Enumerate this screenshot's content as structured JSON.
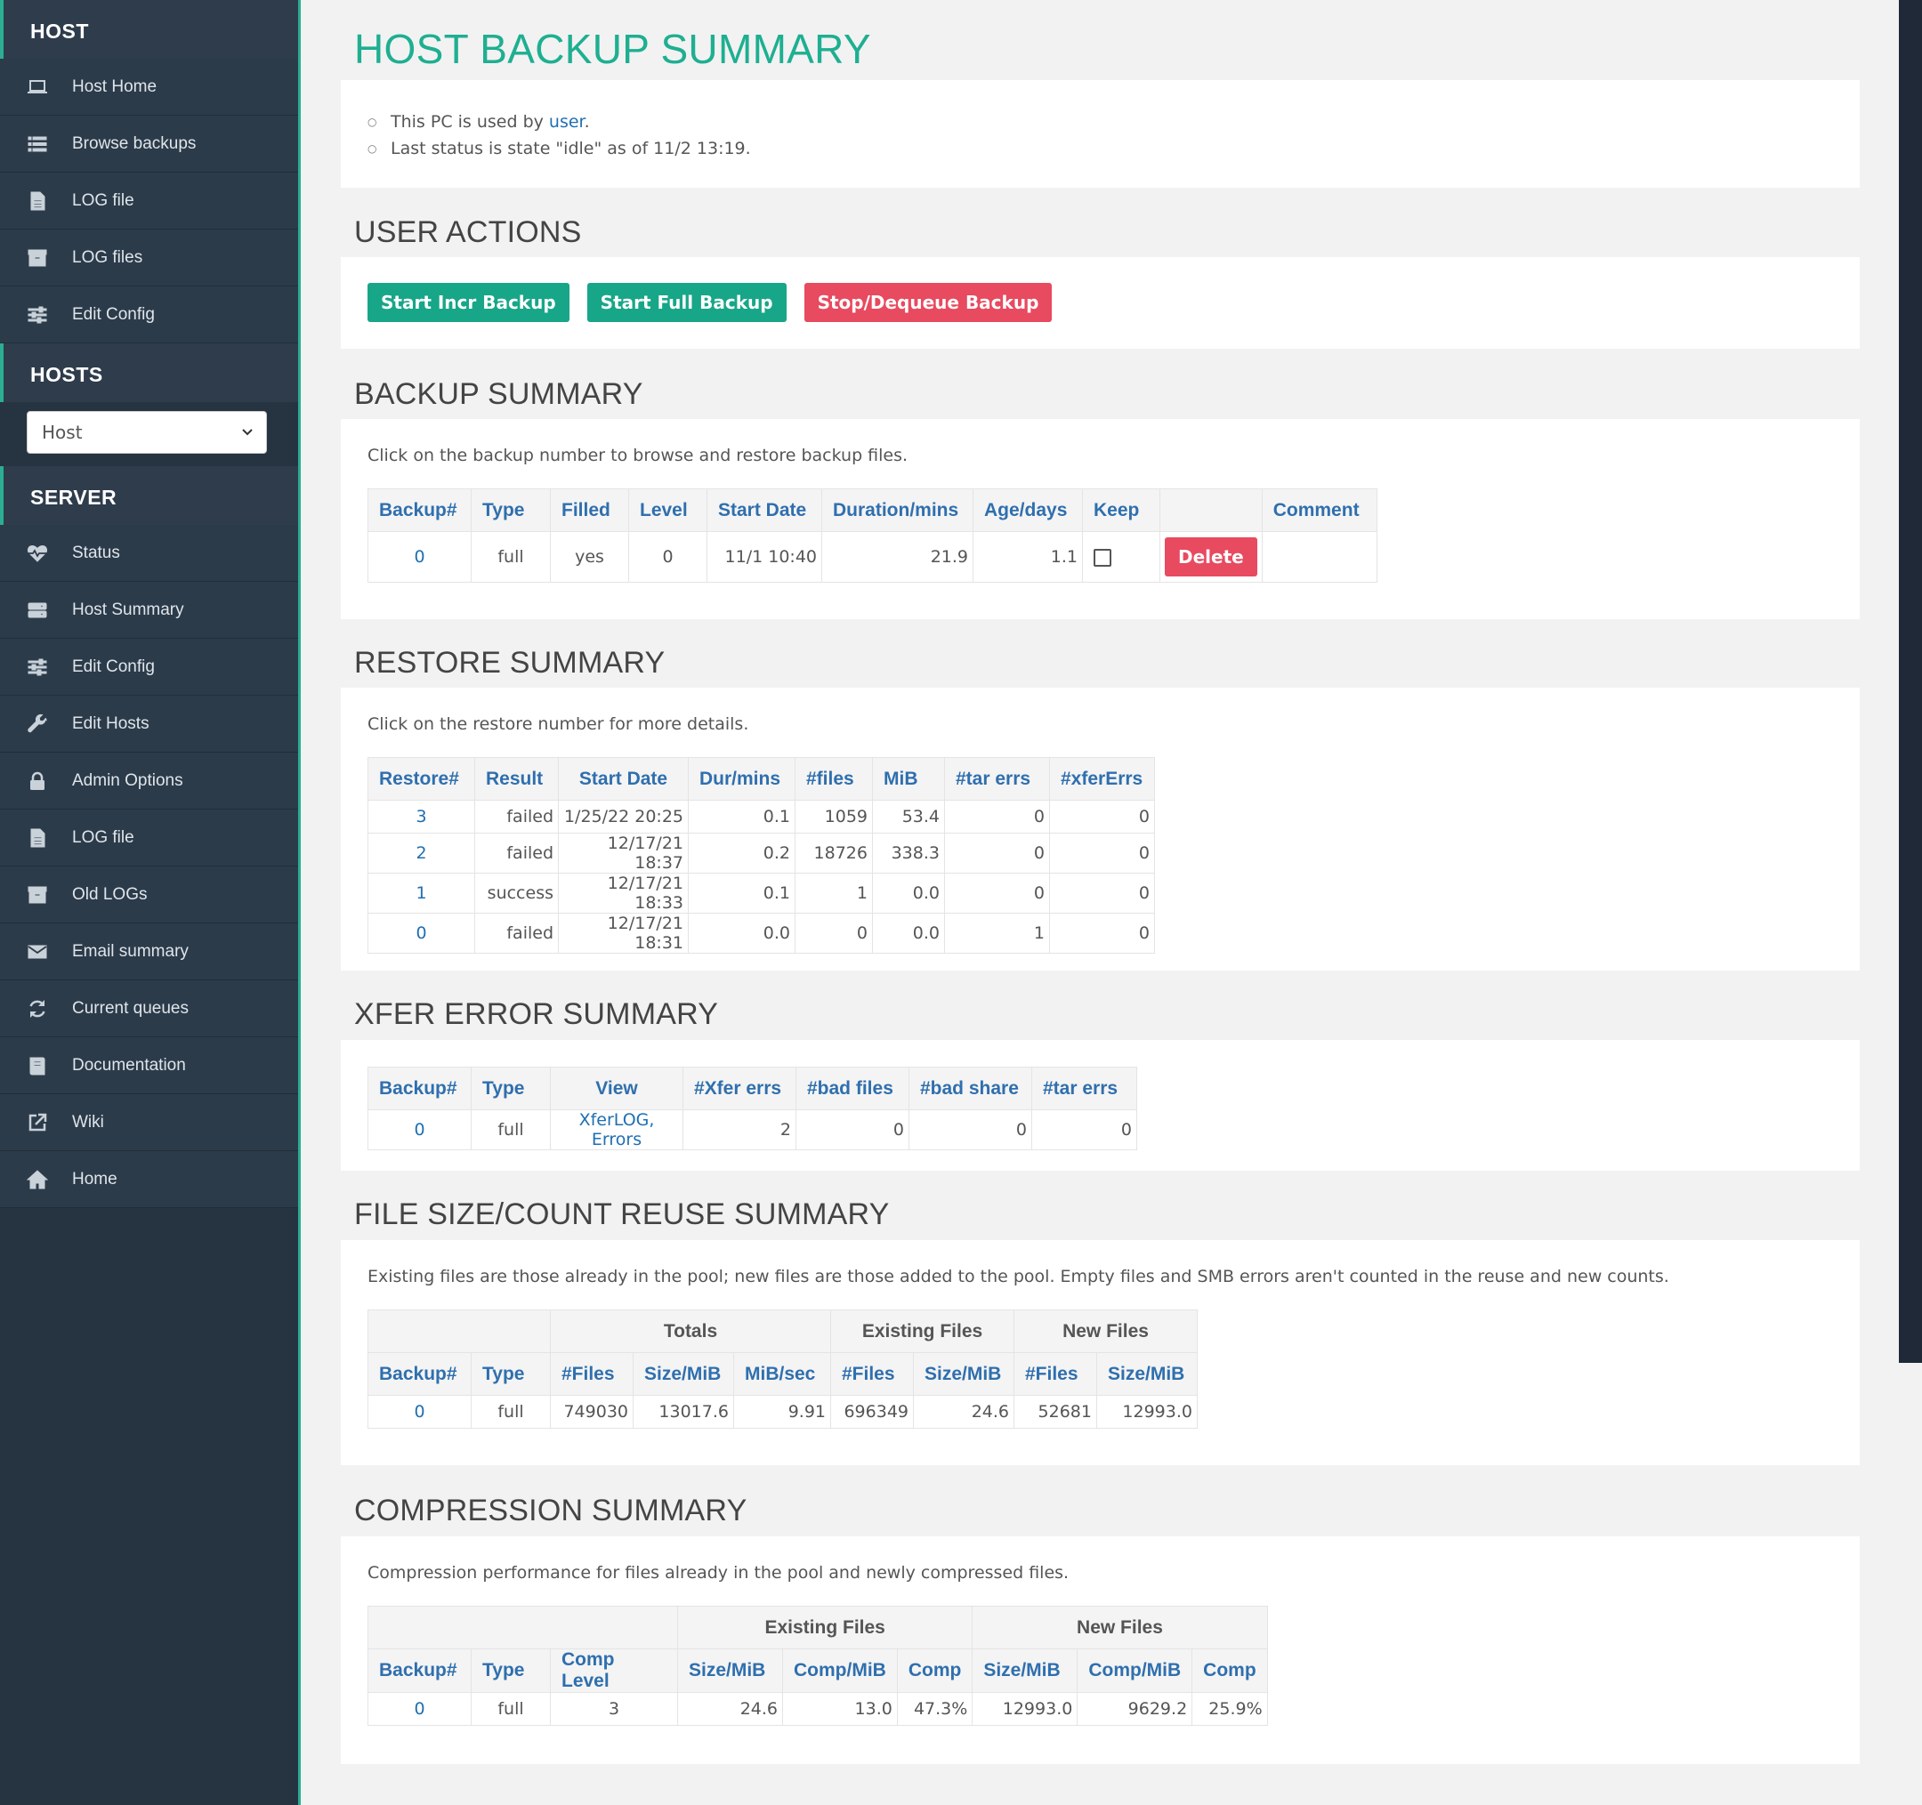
{
  "sidebar": {
    "host_header": "HOST",
    "host_items": [
      {
        "label": "Host Home",
        "icon": "laptop-icon"
      },
      {
        "label": "Browse backups",
        "icon": "list-icon"
      },
      {
        "label": "LOG file",
        "icon": "file-icon"
      },
      {
        "label": "LOG files",
        "icon": "archive-icon"
      },
      {
        "label": "Edit Config",
        "icon": "sliders-icon"
      }
    ],
    "hosts_header": "HOSTS",
    "host_select_value": "Host",
    "server_header": "SERVER",
    "server_items": [
      {
        "label": "Status",
        "icon": "heartbeat-icon"
      },
      {
        "label": "Host Summary",
        "icon": "server-icon"
      },
      {
        "label": "Edit Config",
        "icon": "sliders-icon"
      },
      {
        "label": "Edit Hosts",
        "icon": "wrench-icon"
      },
      {
        "label": "Admin Options",
        "icon": "lock-icon"
      },
      {
        "label": "LOG file",
        "icon": "file-icon"
      },
      {
        "label": "Old LOGs",
        "icon": "archive-icon"
      },
      {
        "label": "Email summary",
        "icon": "envelope-icon"
      },
      {
        "label": "Current queues",
        "icon": "refresh-icon"
      },
      {
        "label": "Documentation",
        "icon": "book-icon"
      },
      {
        "label": "Wiki",
        "icon": "external-link-icon"
      },
      {
        "label": "Home",
        "icon": "home-icon"
      }
    ]
  },
  "page_title": "HOST BACKUP SUMMARY",
  "status": {
    "line1_prefix": "This PC is used by ",
    "line1_user": "user",
    "line1_suffix": ".",
    "line2": "Last status is state \"idle\" as of 11/2 13:19."
  },
  "user_actions": {
    "title": "USER ACTIONS",
    "start_incr": "Start Incr Backup",
    "start_full": "Start Full Backup",
    "stop": "Stop/Dequeue Backup"
  },
  "backup_summary": {
    "title": "BACKUP SUMMARY",
    "note": "Click on the backup number to browse and restore backup files.",
    "headers": [
      "Backup#",
      "Type",
      "Filled",
      "Level",
      "Start Date",
      "Duration/mins",
      "Age/days",
      "Keep",
      "",
      "Comment"
    ],
    "rows": [
      {
        "num": "0",
        "type": "full",
        "filled": "yes",
        "level": "0",
        "start": "11/1 10:40",
        "duration": "21.9",
        "age": "1.1",
        "delete": "Delete",
        "comment": ""
      }
    ]
  },
  "restore_summary": {
    "title": "RESTORE SUMMARY",
    "note": "Click on the restore number for more details.",
    "headers": [
      "Restore#",
      "Result",
      "Start Date",
      "Dur/mins",
      "#files",
      "MiB",
      "#tar errs",
      "#xferErrs"
    ],
    "rows": [
      [
        "3",
        "failed",
        "1/25/22 20:25",
        "0.1",
        "1059",
        "53.4",
        "0",
        "0"
      ],
      [
        "2",
        "failed",
        "12/17/21 18:37",
        "0.2",
        "18726",
        "338.3",
        "0",
        "0"
      ],
      [
        "1",
        "success",
        "12/17/21 18:33",
        "0.1",
        "1",
        "0.0",
        "0",
        "0"
      ],
      [
        "0",
        "failed",
        "12/17/21 18:31",
        "0.0",
        "0",
        "0.0",
        "1",
        "0"
      ]
    ]
  },
  "xfer_summary": {
    "title": "XFER ERROR SUMMARY",
    "headers": [
      "Backup#",
      "Type",
      "View",
      "#Xfer errs",
      "#bad files",
      "#bad share",
      "#tar errs"
    ],
    "row": {
      "num": "0",
      "type": "full",
      "view_a": "XferLOG",
      "view_sep": ", ",
      "view_b": "Errors",
      "xfer": "2",
      "badfiles": "0",
      "badshare": "0",
      "tar": "0"
    }
  },
  "reuse_summary": {
    "title": "FILE SIZE/COUNT REUSE SUMMARY",
    "note": "Existing files are those already in the pool; new files are those added to the pool. Empty files and SMB errors aren't counted in the reuse and new counts.",
    "groups": [
      "Totals",
      "Existing Files",
      "New Files"
    ],
    "headers": [
      "Backup#",
      "Type",
      "#Files",
      "Size/MiB",
      "MiB/sec",
      "#Files",
      "Size/MiB",
      "#Files",
      "Size/MiB"
    ],
    "row": [
      "0",
      "full",
      "749030",
      "13017.6",
      "9.91",
      "696349",
      "24.6",
      "52681",
      "12993.0"
    ]
  },
  "compression_summary": {
    "title": "COMPRESSION SUMMARY",
    "note": "Compression performance for files already in the pool and newly compressed files.",
    "groups": [
      "Existing Files",
      "New Files"
    ],
    "headers": [
      "Backup#",
      "Type",
      "Comp Level",
      "Size/MiB",
      "Comp/MiB",
      "Comp",
      "Size/MiB",
      "Comp/MiB",
      "Comp"
    ],
    "row": [
      "0",
      "full",
      "3",
      "24.6",
      "13.0",
      "47.3%",
      "12993.0",
      "9629.2",
      "25.9%"
    ]
  },
  "colors": {
    "accent": "#1eaf91",
    "link": "#1f6fb2",
    "danger": "#e84a5f",
    "sidebar": "#263341"
  }
}
